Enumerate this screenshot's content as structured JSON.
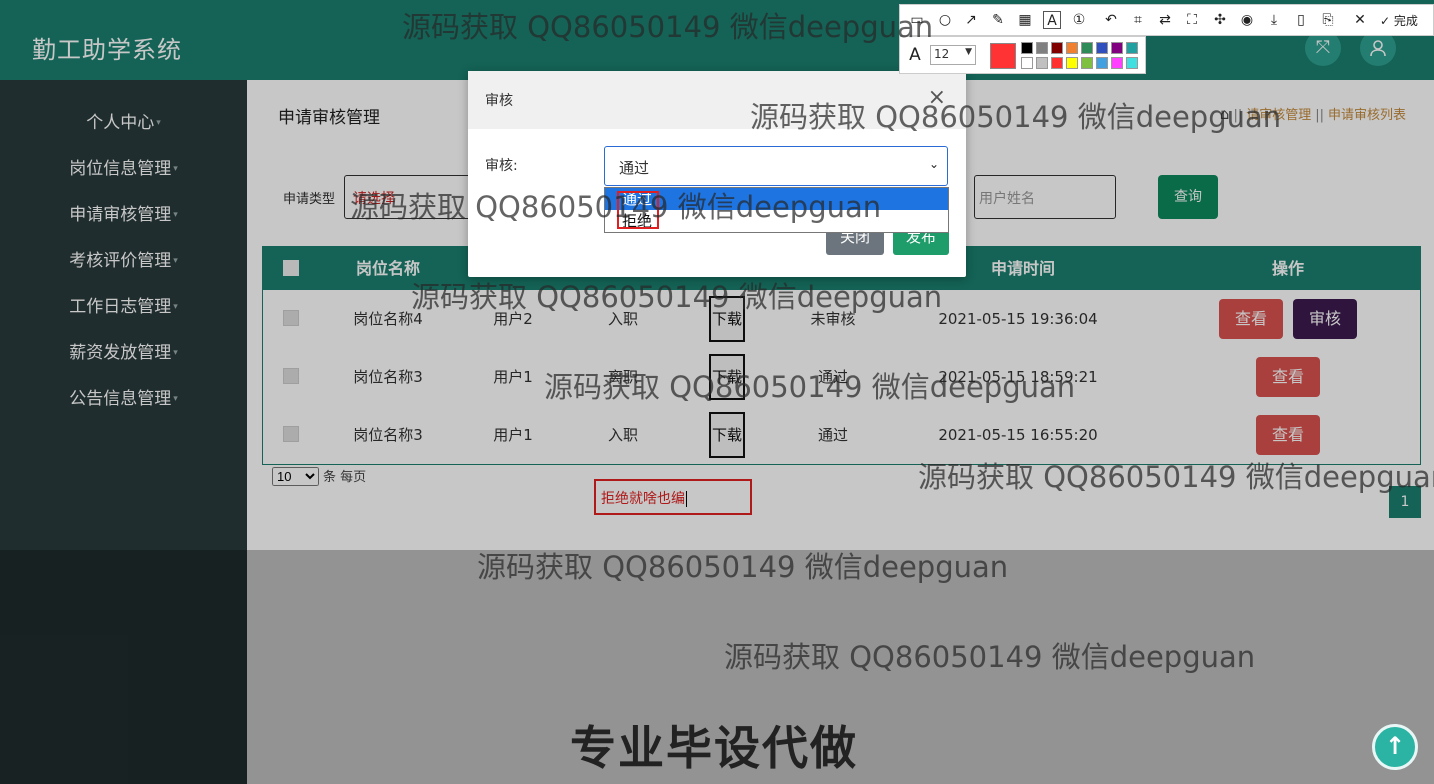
{
  "app": {
    "title": "勤工助学系统"
  },
  "sidebar": {
    "items": [
      {
        "label": "个人中心"
      },
      {
        "label": "岗位信息管理"
      },
      {
        "label": "申请审核管理"
      },
      {
        "label": "考核评价管理"
      },
      {
        "label": "工作日志管理"
      },
      {
        "label": "薪资发放管理"
      },
      {
        "label": "公告信息管理"
      }
    ]
  },
  "page": {
    "title": "申请审核管理",
    "breadcrumb": {
      "current": "申请审核列表",
      "partial": "请审核管理"
    }
  },
  "filters": {
    "type_label": "申请类型",
    "type_value": "请选择",
    "user_placeholder": "用户姓名",
    "query_label": "查询"
  },
  "table": {
    "headers": [
      "岗位名称",
      "申请时间",
      "操作"
    ],
    "rows": [
      {
        "job": "岗位名称4",
        "user": "用户2",
        "type": "入职",
        "download": "下载",
        "status": "未审核",
        "time": "2021-05-15 19:36:04"
      },
      {
        "job": "岗位名称3",
        "user": "用户1",
        "type": "离职",
        "download": "下载",
        "status": "通过",
        "time": "2021-05-15 18:59:21"
      },
      {
        "job": "岗位名称3",
        "user": "用户1",
        "type": "入职",
        "download": "下载",
        "status": "通过",
        "time": "2021-05-15 16:55:20"
      }
    ],
    "view_label": "查看",
    "audit_label": "审核"
  },
  "pagination": {
    "page_size": "10",
    "per_page_suffix": "条 每页",
    "current_page": "1"
  },
  "modal": {
    "title": "审核",
    "close_symbol": "×",
    "field_label": "审核:",
    "selected": "通过",
    "options": [
      "通过",
      "拒绝"
    ],
    "close_label": "关闭",
    "publish_label": "发布"
  },
  "annotation": {
    "text": "拒绝就啥也编"
  },
  "screenshot_toolbar": {
    "done_label": "完成",
    "font_size": "12",
    "text_tool_glyph": "A",
    "current_color": "#ff3333",
    "swatches": [
      "#000000",
      "#808080",
      "#800000",
      "#f08030",
      "#2e8b57",
      "#3050c0",
      "#800080",
      "#20a0a0",
      "#ffffff",
      "#c0c0c0",
      "#ff3030",
      "#ffff00",
      "#80c040",
      "#40a0e0",
      "#ff40ff",
      "#40e0e0"
    ]
  },
  "watermarks": {
    "repeated": "源码获取 QQ86050149 微信deepguan",
    "bottom": "专业毕设代做"
  },
  "colors": {
    "primary": "#1a7f6f",
    "sidebar": "#2a3a3b",
    "danger": "#d9534f",
    "audit": "#3d1c4f",
    "publish": "#1e9c6a"
  }
}
